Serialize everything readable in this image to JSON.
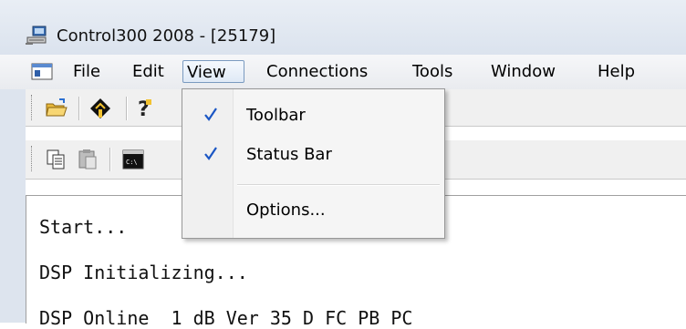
{
  "window": {
    "title": "Control300 2008 - [25179]"
  },
  "menubar": {
    "items": [
      "File",
      "Edit",
      "View",
      "Connections",
      "Tools",
      "Window",
      "Help"
    ],
    "active": "View"
  },
  "view_menu": {
    "items": [
      {
        "label": "Toolbar",
        "checked": true
      },
      {
        "label": "Status Bar",
        "checked": true
      },
      {
        "label": "Options...",
        "checked": false
      }
    ]
  },
  "toolbar1": {
    "icons": [
      "open-folder-icon",
      "plug-icon",
      "help-icon"
    ]
  },
  "toolbar2": {
    "icons": [
      "copy-icon",
      "paste-icon",
      "terminal-icon"
    ]
  },
  "console": {
    "lines": [
      "Start...",
      "DSP Initializing...",
      "DSP Online  1 dB Ver 35 D FC PB PC"
    ]
  },
  "colors": {
    "check": "#1a56c4",
    "menu_highlight_border": "#7a9ac0"
  }
}
